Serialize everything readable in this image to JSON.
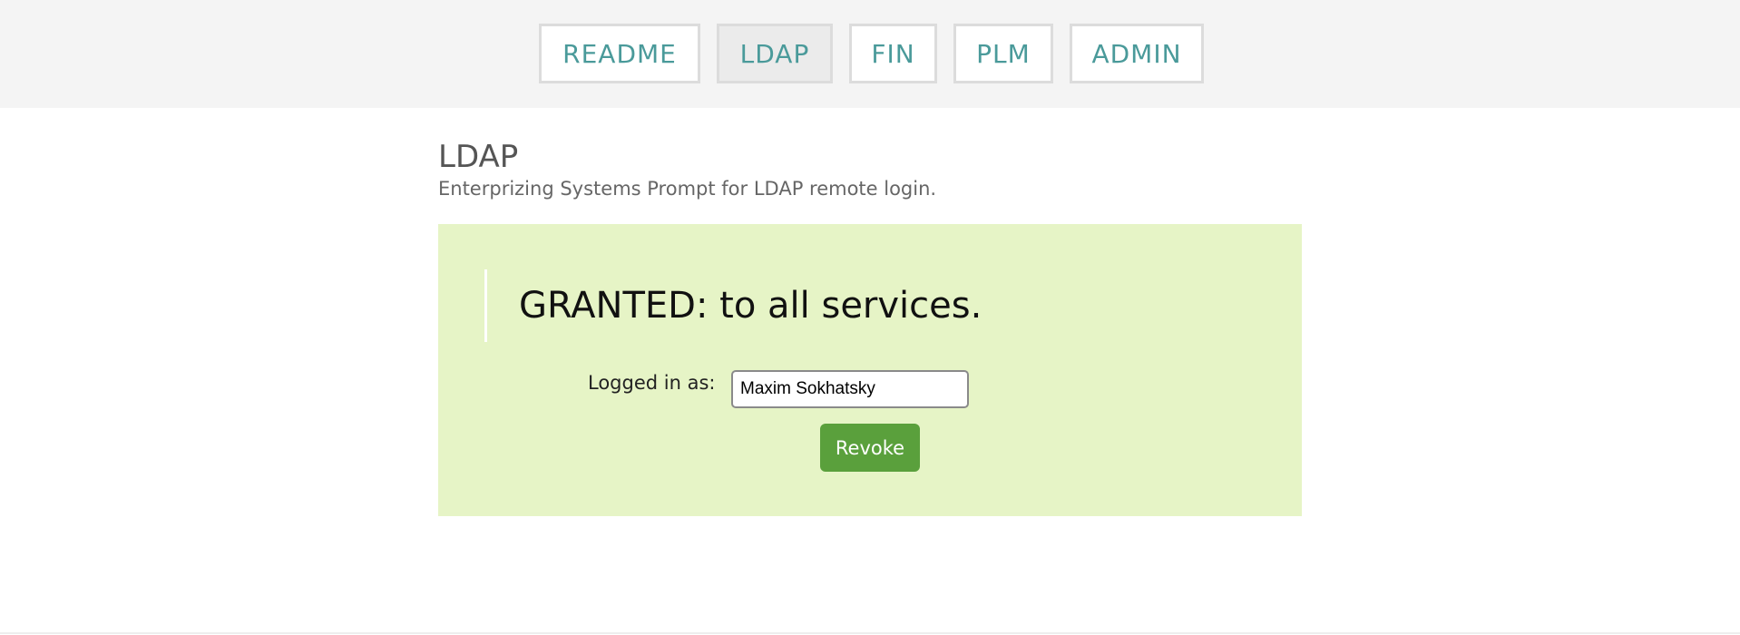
{
  "nav": {
    "tabs": [
      {
        "label": "README"
      },
      {
        "label": "LDAP"
      },
      {
        "label": "FIN"
      },
      {
        "label": "PLM"
      },
      {
        "label": "ADMIN"
      }
    ],
    "active_tab": "LDAP"
  },
  "page": {
    "title": "LDAP",
    "subtitle": "Enterprizing Systems Prompt for LDAP remote login."
  },
  "status": {
    "message": "GRANTED: to all services.",
    "logged_in_label": "Logged in as:",
    "user_value": "Maxim Sokhatsky",
    "revoke_label": "Revoke"
  },
  "colors": {
    "tab_text": "#4a9a9a",
    "panel_bg": "#e6f4c6",
    "revoke_bg": "#5aa03c",
    "topbar_bg": "#f4f4f4"
  }
}
